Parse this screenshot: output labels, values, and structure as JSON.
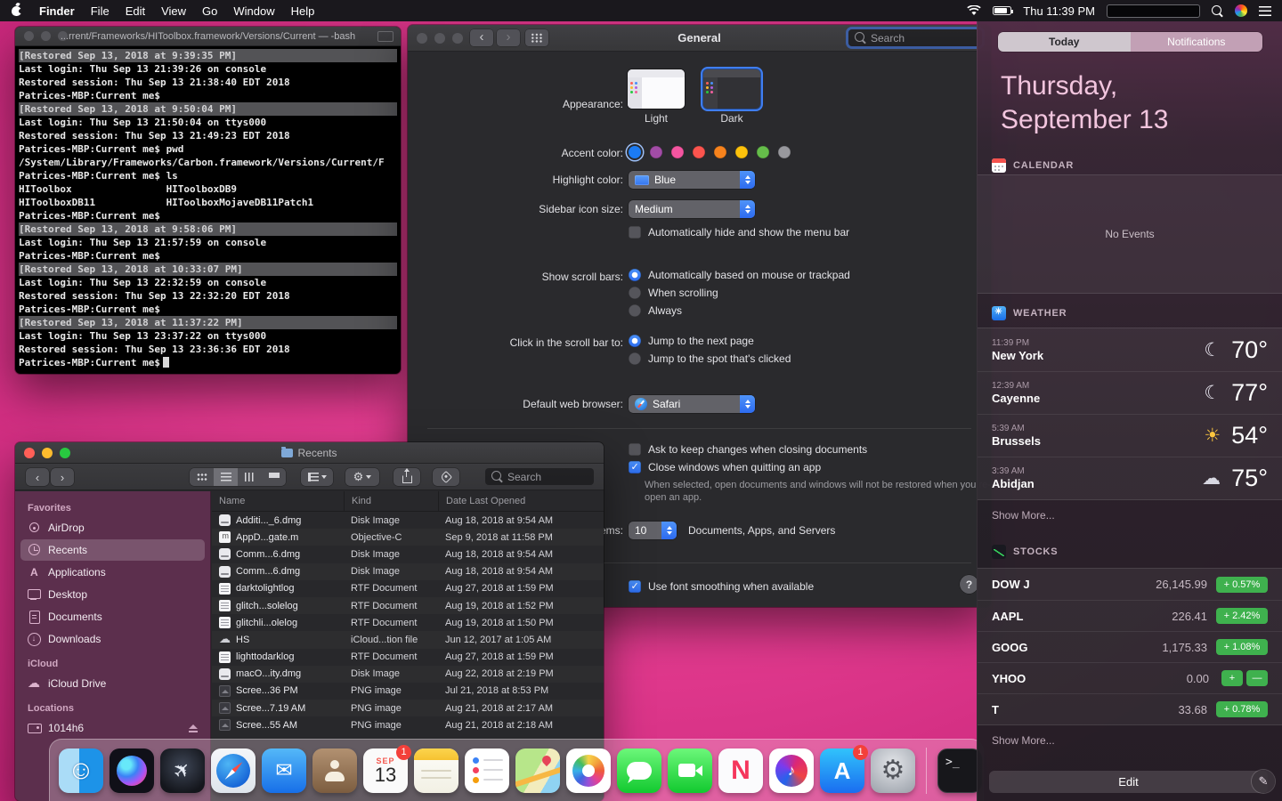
{
  "menu_bar": {
    "app_name": "Finder",
    "menus": [
      "File",
      "Edit",
      "View",
      "Go",
      "Window",
      "Help"
    ],
    "clock": "Thu 11:39 PM"
  },
  "terminal": {
    "title": "...rrent/Frameworks/HIToolbox.framework/Versions/Current — -bash",
    "lines": [
      {
        "text": "[Restored Sep 13, 2018 at 9:39:35 PM]",
        "restored": true
      },
      {
        "text": "Last login: Thu Sep 13 21:39:26 on console"
      },
      {
        "text": "Restored session: Thu Sep 13 21:38:40 EDT 2018"
      },
      {
        "text": "Patrices-MBP:Current me$"
      },
      {
        "text": "[Restored Sep 13, 2018 at 9:50:04 PM]",
        "restored": true
      },
      {
        "text": "Last login: Thu Sep 13 21:50:04 on ttys000"
      },
      {
        "text": "Restored session: Thu Sep 13 21:49:23 EDT 2018"
      },
      {
        "text": "Patrices-MBP:Current me$ pwd"
      },
      {
        "text": "/System/Library/Frameworks/Carbon.framework/Versions/Current/F"
      },
      {
        "text": "Patrices-MBP:Current me$ ls"
      },
      {
        "text": "HIToolbox                HIToolboxDB9"
      },
      {
        "text": "HIToolboxDB11            HIToolboxMojaveDB11Patch1"
      },
      {
        "text": "Patrices-MBP:Current me$"
      },
      {
        "text": "[Restored Sep 13, 2018 at 9:58:06 PM]",
        "restored": true
      },
      {
        "text": "Last login: Thu Sep 13 21:57:59 on console"
      },
      {
        "text": "Patrices-MBP:Current me$"
      },
      {
        "text": "[Restored Sep 13, 2018 at 10:33:07 PM]",
        "restored": true
      },
      {
        "text": "Last login: Thu Sep 13 22:32:59 on console"
      },
      {
        "text": "Restored session: Thu Sep 13 22:32:20 EDT 2018"
      },
      {
        "text": "Patrices-MBP:Current me$"
      },
      {
        "text": "[Restored Sep 13, 2018 at 11:37:22 PM]",
        "restored": true
      },
      {
        "text": "Last login: Thu Sep 13 23:37:22 on ttys000"
      },
      {
        "text": "Restored session: Thu Sep 13 23:36:36 EDT 2018"
      },
      {
        "text": "Patrices-MBP:Current me$",
        "cursor": true
      }
    ]
  },
  "preferences": {
    "window_title": "General",
    "search_placeholder": "Search",
    "appearance_label": "Appearance:",
    "appearance_options": [
      "Light",
      "Dark"
    ],
    "accent_label": "Accent color:",
    "accent_colors": [
      "#1b7bf3",
      "#a24ca6",
      "#f455a0",
      "#fb544e",
      "#f7831d",
      "#fdc20c",
      "#65bd4a",
      "#98989d"
    ],
    "highlight_label": "Highlight color:",
    "highlight_value": "Blue",
    "sidebar_label": "Sidebar icon size:",
    "sidebar_value": "Medium",
    "hide_menubar_label": "Automatically hide and show the menu bar",
    "hide_menubar_checked": false,
    "scrollbars_label": "Show scroll bars:",
    "scrollbars_options": [
      "Automatically based on mouse or trackpad",
      "When scrolling",
      "Always"
    ],
    "scrollbars_selected": 0,
    "scrollclick_label": "Click in the scroll bar to:",
    "scrollclick_options": [
      "Jump to the next page",
      "Jump to the spot that's clicked"
    ],
    "scrollclick_selected": 0,
    "browser_label": "Default web browser:",
    "browser_value": "Safari",
    "ask_keep_label": "Ask to keep changes when closing documents",
    "ask_keep_checked": false,
    "close_windows_label": "Close windows when quitting an app",
    "close_windows_checked": true,
    "close_windows_note": "When selected, open documents and windows will not be restored when you re-open an app.",
    "recent_label": "Recent items:",
    "recent_value": "10",
    "recent_suffix": "Documents, Apps, and Servers",
    "font_smoothing_label": "Use font smoothing when available",
    "font_smoothing_checked": true,
    "help_label": "?"
  },
  "finder": {
    "window_title": "Recents",
    "search_placeholder": "Search",
    "sidebar": [
      {
        "header": "Favorites"
      },
      {
        "label": "AirDrop",
        "icon": "airdrop"
      },
      {
        "label": "Recents",
        "icon": "recents",
        "selected": true
      },
      {
        "label": "Applications",
        "icon": "applications"
      },
      {
        "label": "Desktop",
        "icon": "desktop"
      },
      {
        "label": "Documents",
        "icon": "documents"
      },
      {
        "label": "Downloads",
        "icon": "downloads"
      },
      {
        "header": "iCloud"
      },
      {
        "label": "iCloud Drive",
        "icon": "icloud"
      },
      {
        "header": "Locations"
      },
      {
        "label": "1014h6",
        "icon": "disk",
        "eject": true
      }
    ],
    "columns": [
      "Name",
      "Kind",
      "Date Last Opened"
    ],
    "files": [
      {
        "name": "Additi..._6.dmg",
        "kind": "Disk Image",
        "date": "Aug 18, 2018 at 9:54 AM",
        "icon": "dmg"
      },
      {
        "name": "AppD...gate.m",
        "kind": "Objective-C",
        "date": "Sep 9, 2018 at 11:58 PM",
        "icon": "code"
      },
      {
        "name": "Comm...6.dmg",
        "kind": "Disk Image",
        "date": "Aug 18, 2018 at 9:54 AM",
        "icon": "dmg"
      },
      {
        "name": "Comm...6.dmg",
        "kind": "Disk Image",
        "date": "Aug 18, 2018 at 9:54 AM",
        "icon": "dmg"
      },
      {
        "name": "darktolightlog",
        "kind": "RTF Document",
        "date": "Aug 27, 2018 at 1:59 PM",
        "icon": "doc"
      },
      {
        "name": "glitch...solelog",
        "kind": "RTF Document",
        "date": "Aug 19, 2018 at 1:52 PM",
        "icon": "doc"
      },
      {
        "name": "glitchli...olelog",
        "kind": "RTF Document",
        "date": "Aug 19, 2018 at 1:50 PM",
        "icon": "doc"
      },
      {
        "name": "HS",
        "kind": "iCloud...tion file",
        "date": "Jun 12, 2017 at 1:05 AM",
        "icon": "cloud"
      },
      {
        "name": "lighttodarklog",
        "kind": "RTF Document",
        "date": "Aug 27, 2018 at 1:59 PM",
        "icon": "doc"
      },
      {
        "name": "macO...ity.dmg",
        "kind": "Disk Image",
        "date": "Aug 22, 2018 at 2:19 PM",
        "icon": "dmg"
      },
      {
        "name": "Scree...36 PM",
        "kind": "PNG image",
        "date": "Jul 21, 2018 at 8:53 PM",
        "icon": "png"
      },
      {
        "name": "Scree...7.19 AM",
        "kind": "PNG image",
        "date": "Aug 21, 2018 at 2:17 AM",
        "icon": "png"
      },
      {
        "name": "Scree...55 AM",
        "kind": "PNG image",
        "date": "Aug 21, 2018 at 2:18 AM",
        "icon": "png"
      }
    ]
  },
  "notification_center": {
    "tabs": [
      "Today",
      "Notifications"
    ],
    "selected_tab": "Today",
    "date_line1": "Thursday,",
    "date_line2": "September 13",
    "calendar": {
      "title": "CALENDAR",
      "empty": "No Events"
    },
    "weather": {
      "title": "WEATHER",
      "rows": [
        {
          "time": "11:39 PM",
          "city": "New York",
          "icon": "moon",
          "temp": "70°"
        },
        {
          "time": "12:39 AM",
          "city": "Cayenne",
          "icon": "moon",
          "temp": "77°"
        },
        {
          "time": "5:39 AM",
          "city": "Brussels",
          "icon": "sun",
          "temp": "54°"
        },
        {
          "time": "3:39 AM",
          "city": "Abidjan",
          "icon": "cloud",
          "temp": "75°"
        }
      ],
      "show_more": "Show More..."
    },
    "stocks": {
      "title": "STOCKS",
      "rows": [
        {
          "symbol": "DOW J",
          "value": "26,145.99",
          "change": "+ 0.57%"
        },
        {
          "symbol": "AAPL",
          "value": "226.41",
          "change": "+ 2.42%"
        },
        {
          "symbol": "GOOG",
          "value": "1,175.33",
          "change": "+ 1.08%"
        },
        {
          "symbol": "YHOO",
          "value": "0.00",
          "change_parts": [
            "+",
            "—"
          ]
        },
        {
          "symbol": "T",
          "value": "33.68",
          "change": "+ 0.78%"
        }
      ],
      "show_more": "Show More..."
    },
    "edit_label": "Edit"
  },
  "dock": {
    "items": [
      {
        "name": "finder"
      },
      {
        "name": "siri"
      },
      {
        "name": "launchpad"
      },
      {
        "name": "safari"
      },
      {
        "name": "mail"
      },
      {
        "name": "contacts"
      },
      {
        "name": "calendar",
        "badge": "1",
        "month": "SEP",
        "day": "13"
      },
      {
        "name": "notes"
      },
      {
        "name": "reminders"
      },
      {
        "name": "maps"
      },
      {
        "name": "photos"
      },
      {
        "name": "messages"
      },
      {
        "name": "facetime"
      },
      {
        "name": "news"
      },
      {
        "name": "itunes"
      },
      {
        "name": "appstore",
        "badge": "1"
      },
      {
        "name": "sysprefs"
      },
      {
        "name": "divider"
      },
      {
        "name": "terminal"
      }
    ]
  }
}
